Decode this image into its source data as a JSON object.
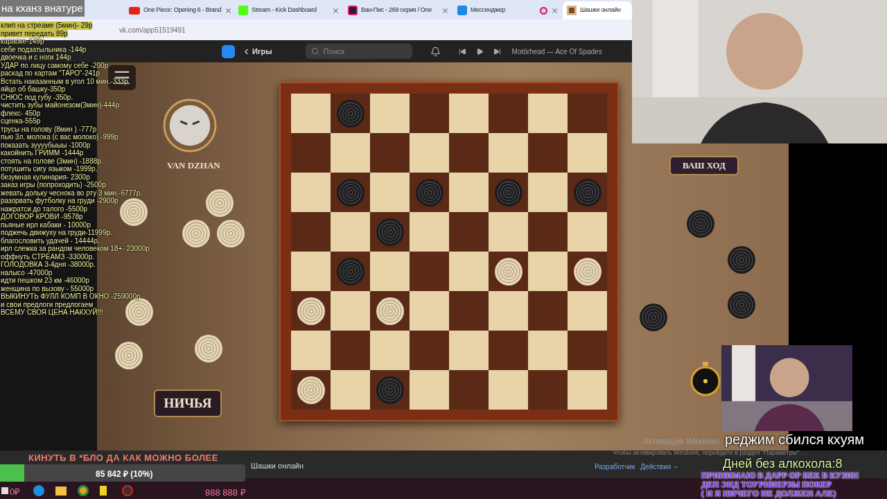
{
  "stream_title": "на кханз внатуре",
  "price_list": [
    {
      "text": "клип на стреаме (5мин)- 29р",
      "highlighted": true
    },
    {
      "text": "привет передать 89р",
      "highlighted": true
    },
    {
      "text": "караоке-149р",
      "highlighted": false
    },
    {
      "text": "себе подзатыльника -144р",
      "highlighted": false
    },
    {
      "text": "двоечка и с ноги 144р",
      "highlighted": false
    },
    {
      "text": "УДАР по лицу самому себе -200р",
      "highlighted": false
    },
    {
      "text": "раскад по картам \"ТАРО\"-241р",
      "highlighted": false
    },
    {
      "text": "Встать наказанным в угол 10 мин.-333р.",
      "highlighted": false
    },
    {
      "text": "яйцо об башку-350р",
      "highlighted": false
    },
    {
      "text": "СНЮС под губу -350р.",
      "highlighted": false
    },
    {
      "text": "чистить зубы майонезом(3мин)-444р.",
      "highlighted": false
    },
    {
      "text": "флекс- 450р",
      "highlighted": false
    },
    {
      "text": "сценка-555р",
      "highlighted": false
    },
    {
      "text": "трусы на голову (8мин ) -777р",
      "highlighted": false
    },
    {
      "text": "пью 3л. молока (с вас молоко) -999р",
      "highlighted": false
    },
    {
      "text": "показать зуууубыыы -1000р",
      "highlighted": false
    },
    {
      "text": "какойнить ГРИММ -1444р",
      "highlighted": false
    },
    {
      "text": "стоять на голове (3мин) -1888р.",
      "highlighted": false
    },
    {
      "text": "потушить сигу языком -1999р.",
      "highlighted": false
    },
    {
      "text": "безумная кулинария- 2300р",
      "highlighted": false
    },
    {
      "text": "заказ игры (попроходить) -2500р",
      "highlighted": false
    },
    {
      "text": "жевать дольку чеснока во рту 3 мин.-6777р.",
      "highlighted": false
    },
    {
      "text": "разорвать футболку на груди -2900р",
      "highlighted": false
    },
    {
      "text": "нажратси до талого -5500р",
      "highlighted": false
    },
    {
      "text": "ДОГОВОР КРОВИ -9578р",
      "highlighted": false
    },
    {
      "text": "пьяные ирл кабаки - 10000р",
      "highlighted": false
    },
    {
      "text": "поджечь движуху на груди-11999р.",
      "highlighted": false
    },
    {
      "text": "благословить удачей - 14444р.",
      "highlighted": false
    },
    {
      "text": "ирл слежка за рандом человеком 18+- 23000р",
      "highlighted": false
    },
    {
      "text": "оффнуть СТРЕАМЗ -33000р.",
      "highlighted": false
    },
    {
      "text": "ГОЛОДОВКА 3-4дня -38000р.",
      "highlighted": false
    },
    {
      "text": "налысо -47000р",
      "highlighted": false
    },
    {
      "text": "идти пешком 23 км -46000р",
      "highlighted": false
    },
    {
      "text": "женщина по вызову - 55000р",
      "highlighted": false
    },
    {
      "text": "ВЫКИНУТЬ ФУЛЛ КОМП В ОКНО -259000р",
      "highlighted": false
    },
    {
      "text": "и свои предлоги предлогаем",
      "highlighted": false
    },
    {
      "text": "ВСЕМУ СВОЯ ЦЕНА НАКХУЙ!!!",
      "highlighted": false
    }
  ],
  "browser_tabs": [
    {
      "title": "One Piece: Opening 6 - Brand",
      "kind": "video",
      "recording": false,
      "selected": false
    },
    {
      "title": "Stream - Kick Dashboard",
      "kind": "kick",
      "recording": false,
      "selected": false
    },
    {
      "title": "Ван-Пис - 269 серия / One",
      "kind": "anime",
      "recording": false,
      "selected": false
    },
    {
      "title": "Мессенджер",
      "kind": "chat",
      "recording": true,
      "selected": false
    },
    {
      "title": "Шашки онлайн",
      "kind": "game",
      "recording": false,
      "selected": true
    }
  ],
  "address": "vk.com/app51519491",
  "vk_header": {
    "back_label": "Игры",
    "search_placeholder": "Поиск",
    "track": "Motörhead — Ace Of Spades"
  },
  "game": {
    "player_name": "VAN DZHAN",
    "draw_button": "НИЧЬЯ",
    "turn_label": "ВАШ ХОД",
    "board": [
      [
        {
          "kind": "empty"
        },
        {
          "kind": "black"
        },
        {
          "kind": "empty"
        },
        {
          "kind": "empty"
        },
        {
          "kind": "empty"
        },
        {
          "kind": "empty"
        },
        {
          "kind": "empty"
        },
        {
          "kind": "empty"
        }
      ],
      [
        {
          "kind": "empty"
        },
        {
          "kind": "empty"
        },
        {
          "kind": "empty"
        },
        {
          "kind": "empty"
        },
        {
          "kind": "empty"
        },
        {
          "kind": "empty"
        },
        {
          "kind": "empty"
        },
        {
          "kind": "empty"
        }
      ],
      [
        {
          "kind": "empty"
        },
        {
          "kind": "black"
        },
        {
          "kind": "empty"
        },
        {
          "kind": "black"
        },
        {
          "kind": "empty"
        },
        {
          "kind": "black"
        },
        {
          "kind": "empty"
        },
        {
          "kind": "black"
        }
      ],
      [
        {
          "kind": "empty"
        },
        {
          "kind": "empty"
        },
        {
          "kind": "black"
        },
        {
          "kind": "empty"
        },
        {
          "kind": "empty"
        },
        {
          "kind": "empty"
        },
        {
          "kind": "empty"
        },
        {
          "kind": "empty"
        }
      ],
      [
        {
          "kind": "empty"
        },
        {
          "kind": "black"
        },
        {
          "kind": "empty"
        },
        {
          "kind": "empty"
        },
        {
          "kind": "empty"
        },
        {
          "kind": "white"
        },
        {
          "kind": "empty"
        },
        {
          "kind": "white"
        }
      ],
      [
        {
          "kind": "white"
        },
        {
          "kind": "empty"
        },
        {
          "kind": "white"
        },
        {
          "kind": "empty"
        },
        {
          "kind": "empty"
        },
        {
          "kind": "empty"
        },
        {
          "kind": "empty"
        },
        {
          "kind": "empty"
        }
      ],
      [
        {
          "kind": "empty"
        },
        {
          "kind": "empty"
        },
        {
          "kind": "empty"
        },
        {
          "kind": "empty"
        },
        {
          "kind": "empty"
        },
        {
          "kind": "empty"
        },
        {
          "kind": "empty"
        },
        {
          "kind": "empty"
        }
      ],
      [
        {
          "kind": "white"
        },
        {
          "kind": "empty"
        },
        {
          "kind": "black"
        },
        {
          "kind": "empty"
        },
        {
          "kind": "empty"
        },
        {
          "kind": "empty"
        },
        {
          "kind": "empty"
        },
        {
          "kind": "empty"
        }
      ]
    ],
    "left_tray": [
      {
        "kind": "white"
      },
      {
        "kind": "white"
      },
      {
        "kind": "white"
      },
      {
        "kind": "white"
      },
      {
        "kind": "white"
      },
      {
        "kind": "white"
      },
      {
        "kind": "white"
      }
    ],
    "right_tray": [
      {
        "kind": "black"
      },
      {
        "kind": "black"
      },
      {
        "kind": "black"
      },
      {
        "kind": "black"
      }
    ]
  },
  "footer": {
    "app_title": "Шашки онлайн",
    "links": [
      "Разработчик",
      "Действия"
    ]
  },
  "windows_notice": {
    "title": "Активация Windows",
    "text": "Чтобы активировать Windows, перейдите в раздел \"Параметры\"."
  },
  "donation": {
    "goal": "КИНУТЬ В *БЛО ДА КАК МОЖНО БОЛЕЕ",
    "level": 0.1,
    "amount": "85 842 ₽ (10%)",
    "start_balance": "0₽",
    "total": "888 888 ₽"
  },
  "captions": {
    "status": "реджим сбился кхуям",
    "counter": "Дней без алкохола:8",
    "notes": [
      "ПРИНИМАЮ В ДАРР ОР БЕК В КУЗИН",
      "ДЕП ЭНД ТОУРНИЕРЗЫ ПОКЕР",
      "( И Я НИЧЕГО НЕ ДОЛЖЕН АЛЕ)"
    ]
  }
}
